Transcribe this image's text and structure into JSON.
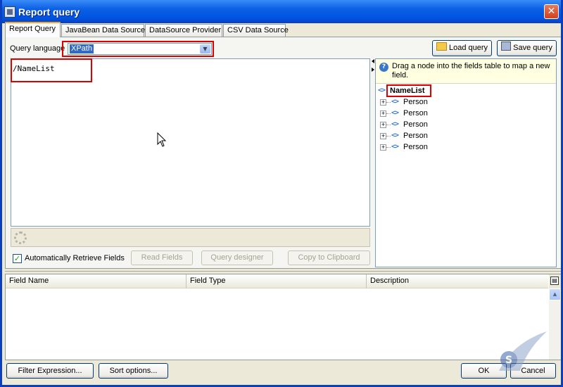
{
  "window": {
    "title": "Report query"
  },
  "tabs": [
    {
      "label": "Report Query",
      "active": true
    },
    {
      "label": "JavaBean Data Source",
      "active": false
    },
    {
      "label": "DataSource Provider",
      "active": false
    },
    {
      "label": "CSV Data Source",
      "active": false
    }
  ],
  "query": {
    "language_label": "Query language",
    "language_value": "XPath",
    "text": "/NameList",
    "load_label": "Load query",
    "save_label": "Save query"
  },
  "options": {
    "auto_retrieve_label": "Automatically Retrieve Fields",
    "auto_retrieve_checked": true,
    "read_fields_label": "Read Fields",
    "query_designer_label": "Query designer",
    "copy_clipboard_label": "Copy to Clipboard"
  },
  "tree": {
    "hint": "Drag a node into the fields table to map a new field.",
    "root": "NameList",
    "children": [
      "Person",
      "Person",
      "Person",
      "Person",
      "Person"
    ]
  },
  "fields_table": {
    "columns": [
      "Field Name",
      "Field Type",
      "Description"
    ]
  },
  "footer": {
    "filter_label": "Filter Expression...",
    "sort_label": "Sort options...",
    "ok_label": "OK",
    "cancel_label": "Cancel"
  },
  "colors": {
    "titlebar": "#0a5fe4",
    "highlight_box": "#dd0000",
    "selection": "#316ac5"
  }
}
